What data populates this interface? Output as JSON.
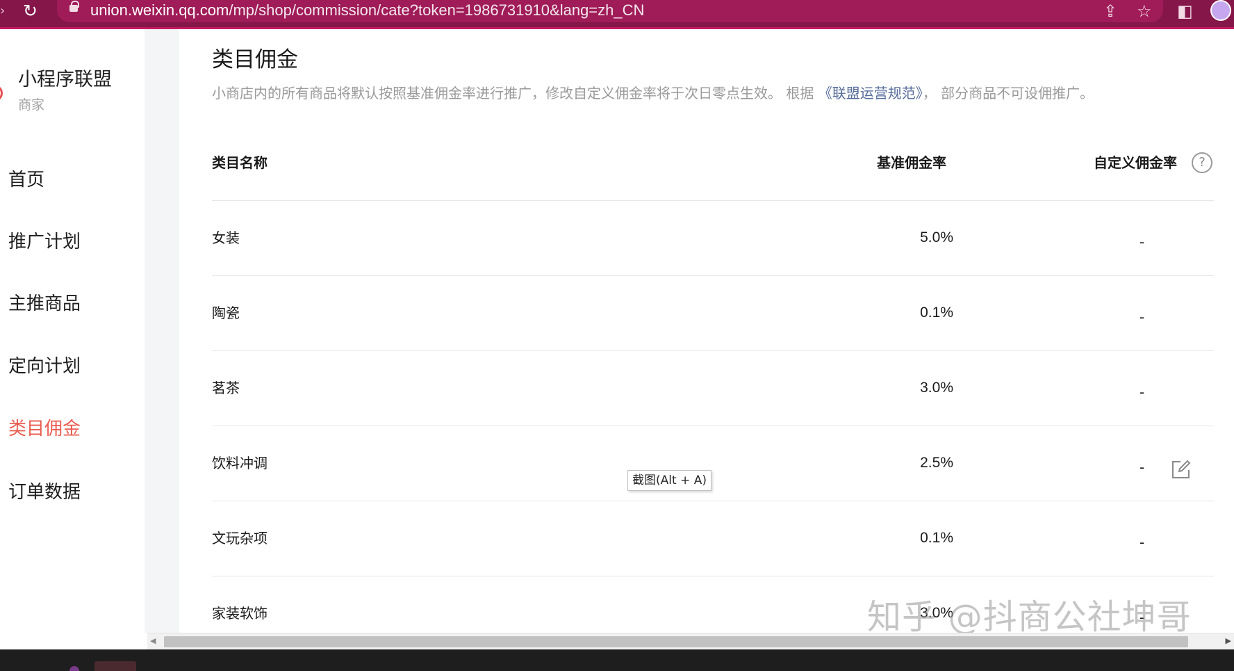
{
  "browser": {
    "url_host": "union.weixin.qq.com",
    "url_path": "/mp/shop/commission/cate?token=1986731910&lang=zh_CN"
  },
  "sidebar": {
    "brand_title": "小程序联盟",
    "brand_subtitle": "商家",
    "items": [
      {
        "label": "首页"
      },
      {
        "label": "推广计划"
      },
      {
        "label": "主推商品"
      },
      {
        "label": "定向计划"
      },
      {
        "label": "类目佣金",
        "active": true
      },
      {
        "label": "订单数据"
      }
    ]
  },
  "page": {
    "title": "类目佣金",
    "desc_before": "小商店内的所有商品将默认按照基准佣金率进行推广，修改自定义佣金率将于次日零点生效。 根据 ",
    "desc_link": "《联盟运营规范》",
    "desc_after": "， 部分商品不可设佣推广。"
  },
  "table": {
    "headers": {
      "name": "类目名称",
      "base_rate": "基准佣金率",
      "custom_rate": "自定义佣金率"
    },
    "rows": [
      {
        "name": "女装",
        "base_rate": "5.0%",
        "custom_rate": "-"
      },
      {
        "name": "陶瓷",
        "base_rate": "0.1%",
        "custom_rate": "-"
      },
      {
        "name": "茗茶",
        "base_rate": "3.0%",
        "custom_rate": "-"
      },
      {
        "name": "饮料冲调",
        "base_rate": "2.5%",
        "custom_rate": "-"
      },
      {
        "name": "文玩杂项",
        "base_rate": "0.1%",
        "custom_rate": "-"
      },
      {
        "name": "家装软饰",
        "base_rate": "3.0%",
        "custom_rate": "-"
      }
    ]
  },
  "tooltip": {
    "text": "截图(Alt + A)"
  },
  "watermark": {
    "text": "知乎 @抖商公社坤哥"
  },
  "colors": {
    "browser_bar": "#84164a",
    "active_nav": "#ea5c50",
    "link": "#556b9a"
  }
}
